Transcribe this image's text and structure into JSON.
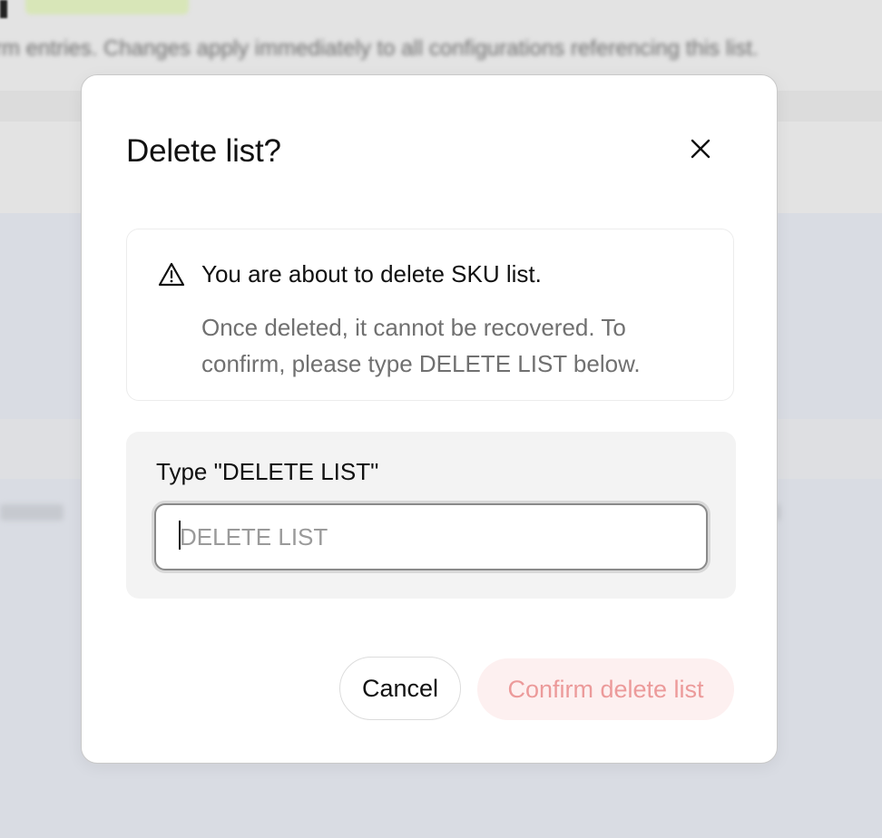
{
  "background": {
    "text": "rm entries. Changes apply immediately to all configurations referencing this list."
  },
  "modal": {
    "title": "Delete list?",
    "close_icon": "close-icon",
    "warning": {
      "icon": "warning-triangle-icon",
      "title": "You are about to delete SKU list.",
      "body": "Once deleted, it cannot be recovered. To confirm, please type DELETE LIST below."
    },
    "confirm_field": {
      "label": "Type \"DELETE LIST\"",
      "placeholder": "DELETE LIST",
      "value": ""
    },
    "buttons": {
      "cancel": "Cancel",
      "confirm": "Confirm delete list"
    }
  },
  "colors": {
    "confirm_disabled_bg": "#fdf0f0",
    "confirm_disabled_text": "#ec9a9a",
    "overlay": "#d9dce3"
  }
}
